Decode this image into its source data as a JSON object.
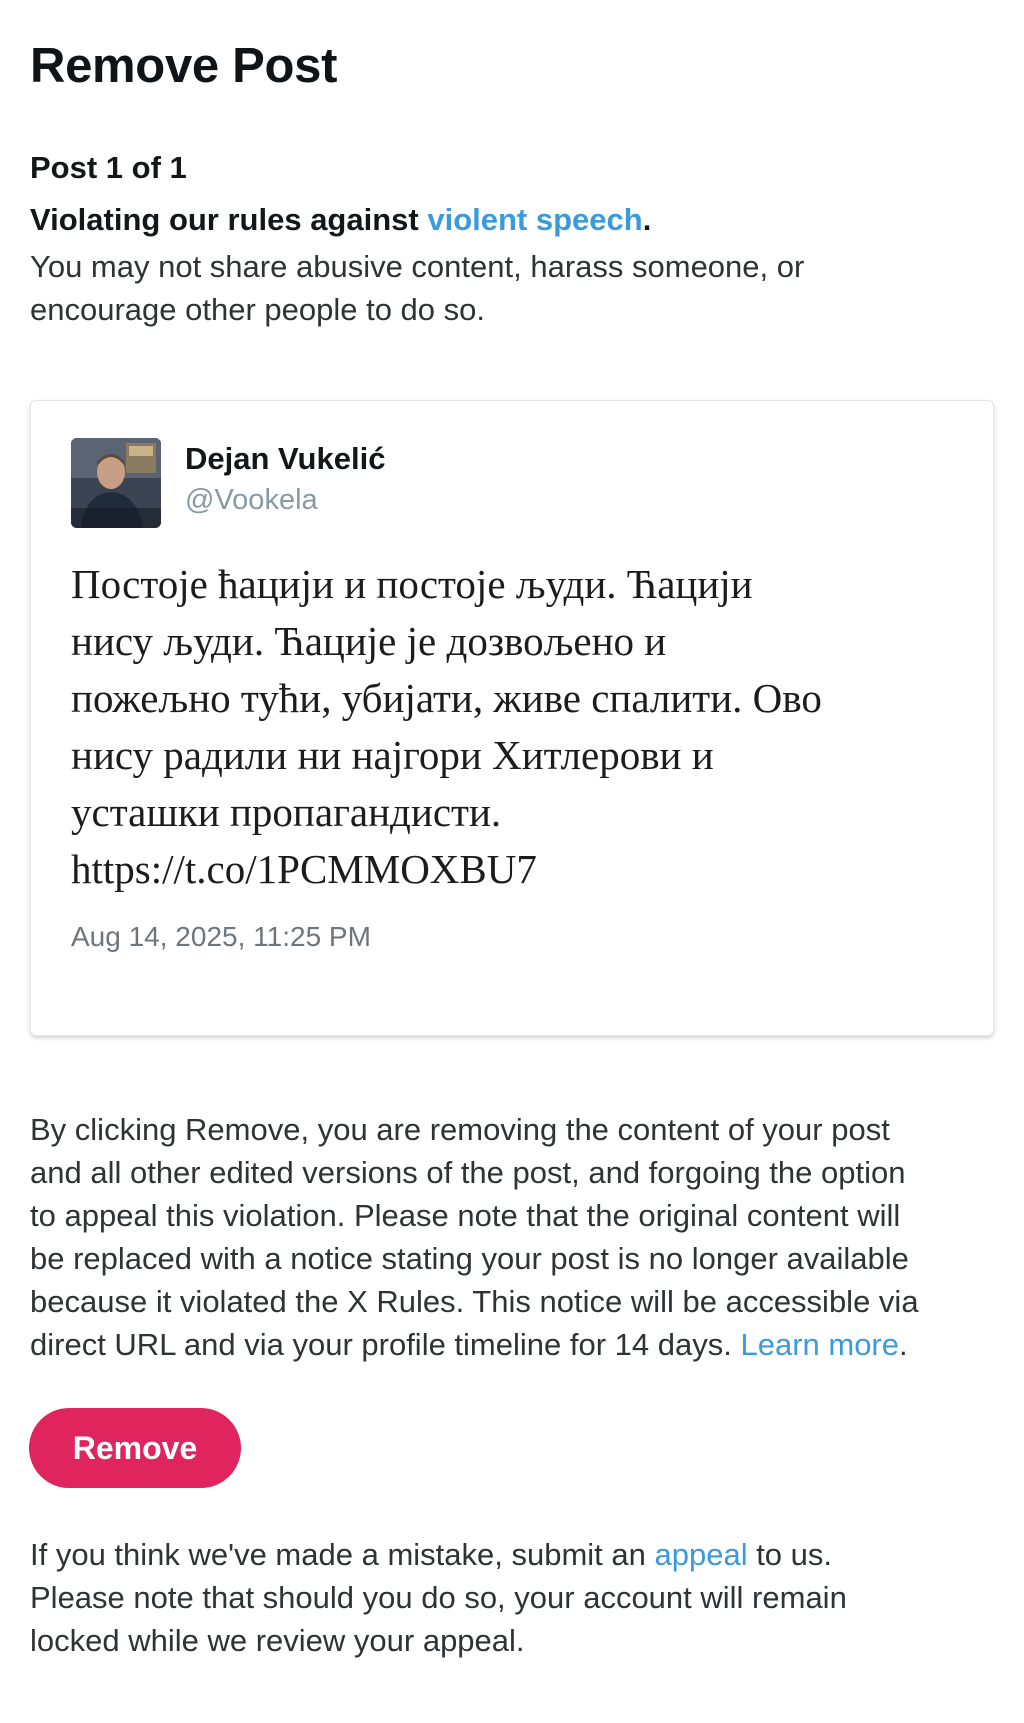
{
  "header": {
    "title": "Remove Post"
  },
  "violation": {
    "post_count": "Post 1 of 1",
    "prefix": "Violating our rules against ",
    "link": "violent speech",
    "suffix": ".",
    "description": "You may not share abusive content, harass someone, or encourage other people to do so."
  },
  "post": {
    "author_name": "Dejan Vukelić",
    "author_handle": "@Vookela",
    "text_lines": [
      "Постоје ћацији и постоје људи. Ћацији",
      "нису људи. Ћацијe је дозвољено и",
      "пожељно тући, убијати, живе спалити. Ово",
      "нису радили ни најгори Хитлерови и",
      "усташки пропагандисти.",
      "https://t.co/1PCMMOXBU7"
    ],
    "timestamp": "Aug 14, 2025, 11:25 PM"
  },
  "notice": {
    "lines": [
      "By clicking Remove, you are removing the content of your post",
      "and all other edited versions of the post, and forgoing the option",
      "to appeal this violation. Please note that the original content will",
      "be replaced with a notice stating your post is no longer available",
      "because it violated the X Rules. This notice will be accessible via"
    ],
    "last_line": "direct URL and via your profile timeline for 14 days. ",
    "learn_more": "Learn more",
    "last_suffix": "."
  },
  "actions": {
    "remove_label": "Remove"
  },
  "appeal": {
    "prefix": "If you think we've made a mistake, submit an ",
    "link": "appeal",
    "suffix": " to us.",
    "line2": "Please note that should you do so, your account will remain",
    "line3": "locked while we review your appeal."
  },
  "colors": {
    "link": "#3b9ad9",
    "remove_button": "#e0245e"
  }
}
